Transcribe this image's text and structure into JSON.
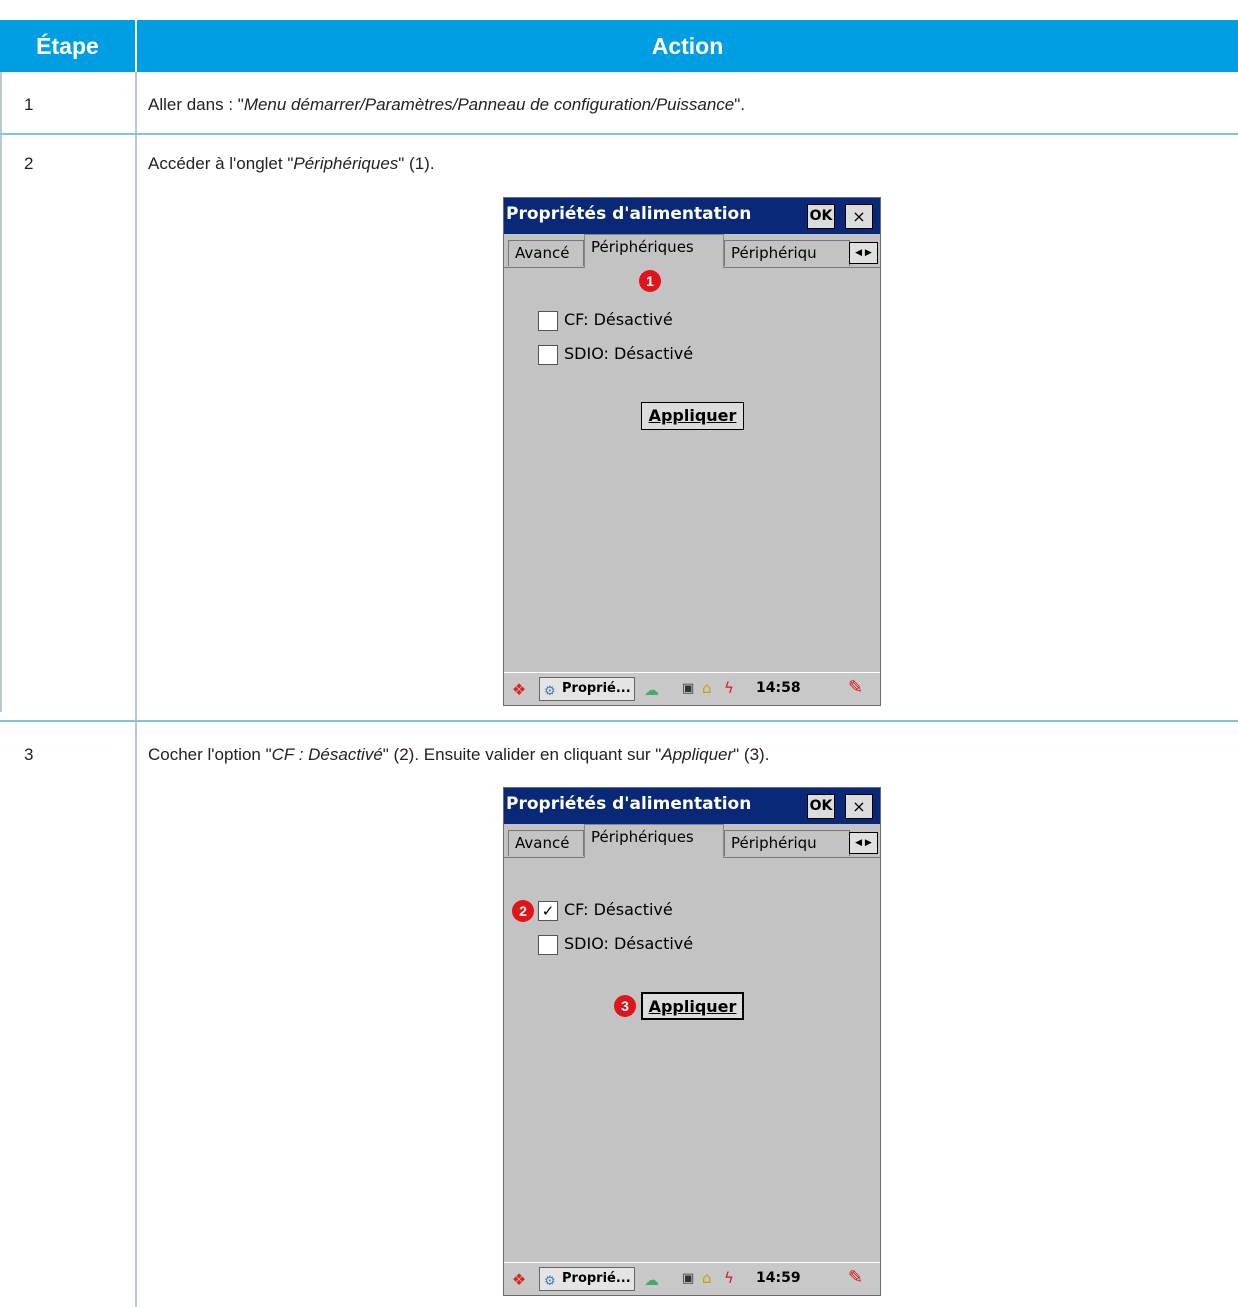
{
  "table": {
    "header": {
      "step": "Étape",
      "action": "Action"
    },
    "rows": [
      {
        "step": "1",
        "text_before": "Aller dans : \"",
        "text_italic": "Menu démarrer/Paramètres/Panneau de configuration/Puissance",
        "text_after": "\"."
      },
      {
        "step": "2",
        "text_before": "Accéder à l'onglet \"",
        "text_italic": "Périphériques",
        "text_after": "\" (1)."
      },
      {
        "step": "3",
        "text_before": "Cocher l'option \"",
        "text_italic": "CF : Désactivé",
        "text_after": "\" (2). Ensuite valider en cliquant sur \"",
        "text_italic2": "Appliquer",
        "text_after2": "\" (3)."
      }
    ]
  },
  "screens": [
    {
      "title": "Propriétés d'alimentation",
      "ok": "OK",
      "close": "×",
      "tabs": [
        "Avancé",
        "Périphériques",
        "Périphériqu"
      ],
      "checkboxes": [
        {
          "label": "CF: Désactivé",
          "checked": false
        },
        {
          "label": "SDIO: Désactivé",
          "checked": false
        }
      ],
      "apply": "Appliquer",
      "task": "Proprié...",
      "clock": "14:58",
      "badge": "1"
    },
    {
      "title": "Propriétés d'alimentation",
      "ok": "OK",
      "close": "×",
      "tabs": [
        "Avancé",
        "Périphériques",
        "Périphériqu"
      ],
      "checkboxes": [
        {
          "label": "CF: Désactivé",
          "checked": true,
          "mark": "✓"
        },
        {
          "label": "SDIO: Désactivé",
          "checked": false
        }
      ],
      "apply": "Appliquer",
      "task": "Proprié...",
      "clock": "14:59",
      "badge_cf": "2",
      "badge_apply": "3"
    }
  ],
  "colors": {
    "header": "#009ee3",
    "title_bar": "#0a2878",
    "badge": "#e0141b"
  }
}
